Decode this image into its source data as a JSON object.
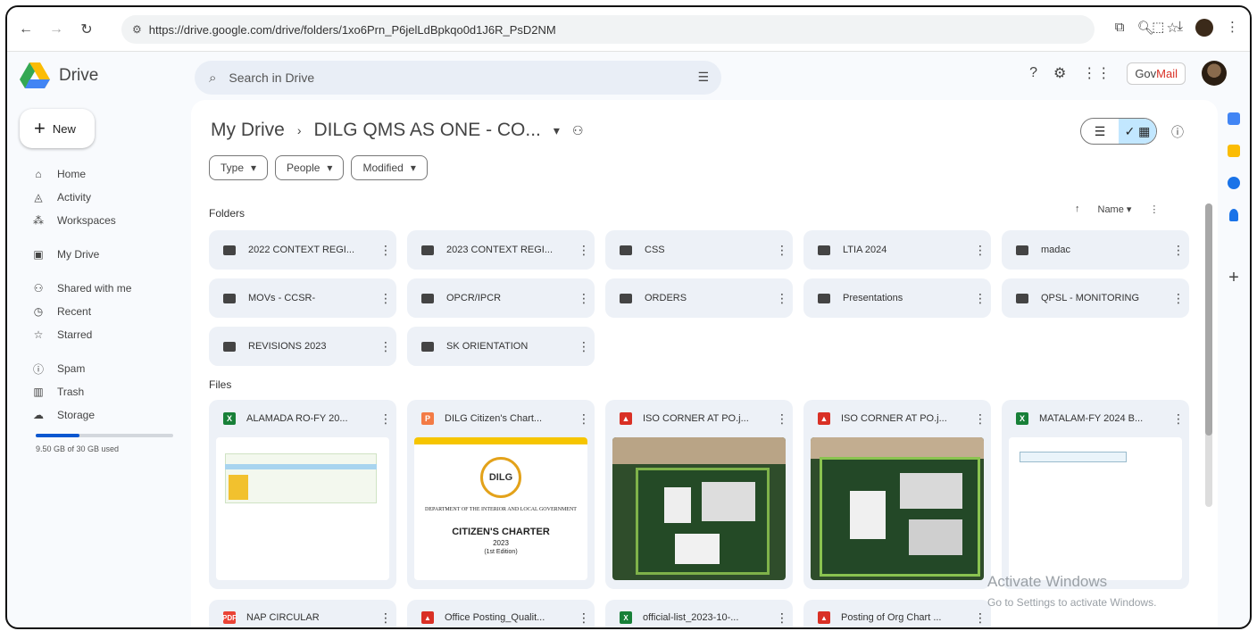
{
  "browser": {
    "url": "https://drive.google.com/drive/folders/1xo6Prn_P6jelLdBpkqo0d1J6R_PsD2NM",
    "back_icon": "arrow-left-icon",
    "forward_icon": "arrow-right-icon",
    "reload_icon": "reload-icon"
  },
  "app": {
    "name": "Drive",
    "search_placeholder": "Search in Drive",
    "govmail_prefix": "Gov",
    "govmail_suffix": "Mail"
  },
  "sidebar": {
    "new_label": "New",
    "items": [
      {
        "label": "Home",
        "icon": "home-icon",
        "glyph": "⌂"
      },
      {
        "label": "Activity",
        "icon": "bell-icon",
        "glyph": "◬"
      },
      {
        "label": "Workspaces",
        "icon": "workspaces-icon",
        "glyph": "⁂"
      },
      {
        "label": "My Drive",
        "icon": "my-drive-icon",
        "glyph": "▣"
      },
      {
        "label": "Shared with me",
        "icon": "people-icon",
        "glyph": "⚇"
      },
      {
        "label": "Recent",
        "icon": "clock-icon",
        "glyph": "◷"
      },
      {
        "label": "Starred",
        "icon": "star-icon",
        "glyph": "☆"
      },
      {
        "label": "Spam",
        "icon": "spam-icon",
        "glyph": "ⓘ"
      },
      {
        "label": "Trash",
        "icon": "trash-icon",
        "glyph": "▥"
      },
      {
        "label": "Storage",
        "icon": "cloud-icon",
        "glyph": "☁"
      }
    ],
    "storage_text": "9.50 GB of 30 GB used",
    "storage_fraction": 0.32
  },
  "main": {
    "breadcrumb_root": "My Drive",
    "breadcrumb_current": "DILG QMS AS ONE - CO...",
    "filters": [
      "Type",
      "People",
      "Modified"
    ],
    "folders_label": "Folders",
    "files_label": "Files",
    "sort_label": "Name",
    "folders": [
      "2022 CONTEXT REGI...",
      "2023 CONTEXT REGI...",
      "CSS",
      "LTIA 2024",
      "madac",
      "MOVs - CCSR-",
      "OPCR/IPCR",
      "ORDERS",
      "Presentations",
      "QPSL - MONITORING",
      "REVISIONS 2023",
      "SK ORIENTATION"
    ],
    "files": [
      {
        "name": "ALAMADA RO-FY 20...",
        "type": "X",
        "color": "#188038"
      },
      {
        "name": "DILG Citizen's Chart...",
        "type": "P",
        "color": "#f37b45"
      },
      {
        "name": "ISO CORNER AT PO.j...",
        "type": "▲",
        "color": "#d93025"
      },
      {
        "name": "ISO CORNER AT PO.j...",
        "type": "▲",
        "color": "#d93025"
      },
      {
        "name": "MATALAM-FY 2024 B...",
        "type": "X",
        "color": "#188038"
      }
    ],
    "files_bottom": [
      {
        "name": "NAP CIRCULAR",
        "type": "PDF",
        "color": "#ea4335"
      },
      {
        "name": "Office Posting_Qualit...",
        "type": "▲",
        "color": "#d93025"
      },
      {
        "name": "official-list_2023-10-...",
        "type": "X",
        "color": "#188038"
      },
      {
        "name": "Posting of Org Chart ...",
        "type": "▲",
        "color": "#d93025"
      }
    ],
    "citizen_thumb": {
      "logo": "DILG",
      "dept": "DEPARTMENT OF THE INTERIOR AND LOCAL GOVERNMENT",
      "title": "CITIZEN'S CHARTER",
      "year": "2023",
      "edition": "(1st Edition)"
    }
  },
  "watermark": {
    "line1": "Activate Windows",
    "line2": "Go to Settings to activate Windows."
  }
}
